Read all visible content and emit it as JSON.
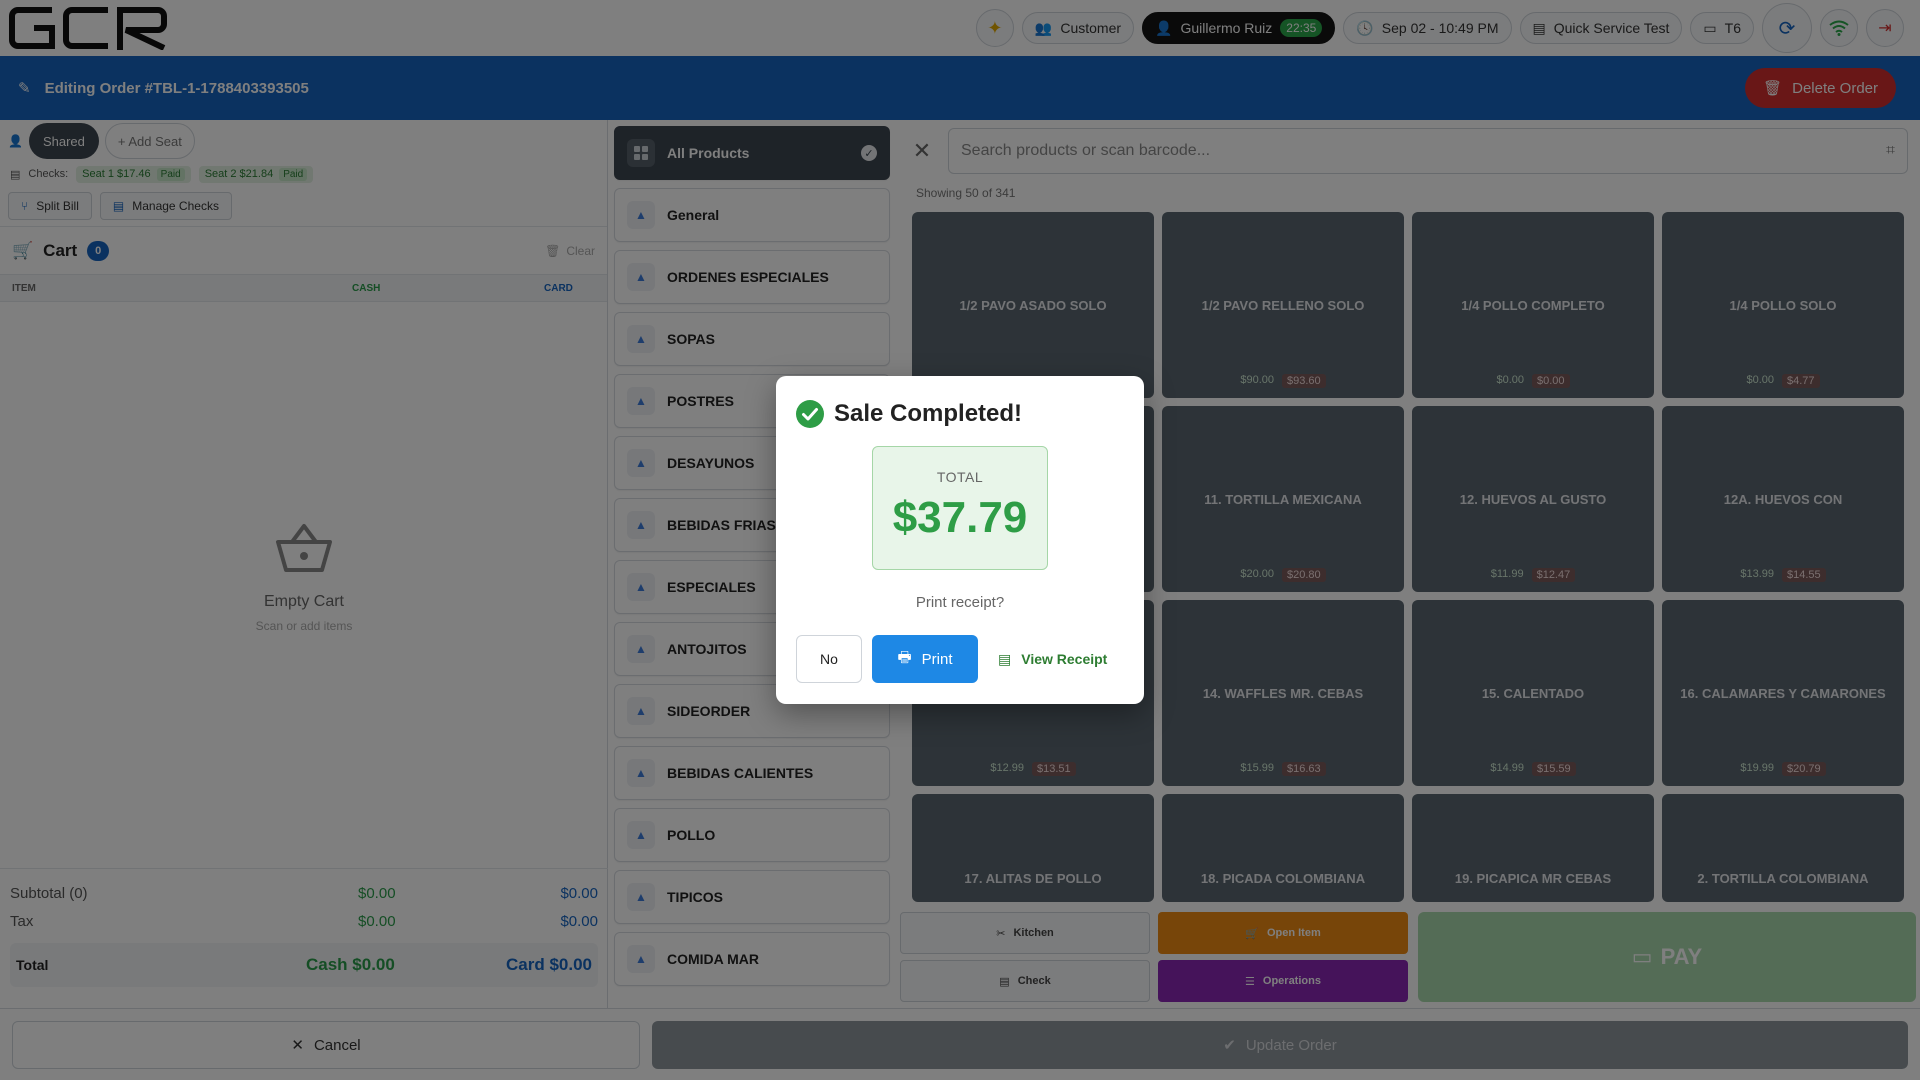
{
  "app": {
    "logo_text": "GCR"
  },
  "topbar": {
    "customer_label": "Customer",
    "user_name": "Guillermo Ruiz",
    "user_time": "22:35",
    "datetime": "Sep 02 - 10:49 PM",
    "store": "Quick Service Test",
    "terminal": "T6"
  },
  "header": {
    "title": "Editing Order #TBL-1-1788403393505",
    "delete_label": "Delete Order"
  },
  "seats": {
    "shared_label": "Shared",
    "add_label": "+ Add Seat",
    "checks_label": "Checks:",
    "checks": [
      {
        "label": "Seat 1 $17.46",
        "status": "Paid"
      },
      {
        "label": "Seat 2 $21.84",
        "status": "Paid"
      }
    ],
    "split_label": "Split Bill",
    "manage_label": "Manage Checks"
  },
  "cart": {
    "title": "Cart",
    "count": "0",
    "clear_label": "Clear",
    "col_item": "ITEM",
    "col_cash": "CASH",
    "col_card": "CARD",
    "empty_title": "Empty Cart",
    "empty_sub": "Scan or add items",
    "subtotal_label": "Subtotal (0)",
    "subtotal_cash": "$0.00",
    "subtotal_card": "$0.00",
    "tax_label": "Tax",
    "tax_cash": "$0.00",
    "tax_card": "$0.00",
    "total_label": "Total",
    "total_cash": "Cash $0.00",
    "total_card": "Card $0.00"
  },
  "categories": [
    "All Products",
    "General",
    "ORDENES ESPECIALES",
    "SOPAS",
    "POSTRES",
    "DESAYUNOS",
    "BEBIDAS FRIAS",
    "ESPECIALES",
    "ANTOJITOS",
    "SIDEORDER",
    "BEBIDAS CALIENTES",
    "POLLO",
    "TIPICOS",
    "COMIDA MAR"
  ],
  "search": {
    "placeholder": "Search products or scan barcode...",
    "showing": "Showing 50 of 341"
  },
  "products": [
    {
      "name": "1/2 PAVO ASADO SOLO",
      "cash": "",
      "card": ""
    },
    {
      "name": "1/2 PAVO RELLENO SOLO",
      "cash": "$90.00",
      "card": "$93.60"
    },
    {
      "name": "1/4 POLLO COMPLETO",
      "cash": "$0.00",
      "card": "$0.00"
    },
    {
      "name": "1/4 POLLO SOLO",
      "cash": "$0.00",
      "card": "$4.77"
    },
    {
      "name": "",
      "cash": "",
      "card": ""
    },
    {
      "name": "11. TORTILLA MEXICANA",
      "cash": "$20.00",
      "card": "$20.80"
    },
    {
      "name": "12. HUEVOS AL GUSTO",
      "cash": "$11.99",
      "card": "$12.47"
    },
    {
      "name": "12A. HUEVOS CON",
      "cash": "$13.99",
      "card": "$14.55"
    },
    {
      "name": "",
      "cash": "$12.99",
      "card": "$13.51"
    },
    {
      "name": "14. WAFFLES MR. CEBAS",
      "cash": "$15.99",
      "card": "$16.63"
    },
    {
      "name": "15. CALENTADO",
      "cash": "$14.99",
      "card": "$15.59"
    },
    {
      "name": "16. CALAMARES Y CAMARONES",
      "cash": "$19.99",
      "card": "$20.79"
    },
    {
      "name": "17. ALITAS DE POLLO",
      "cash": "",
      "card": ""
    },
    {
      "name": "18. PICADA COLOMBIANA",
      "cash": "",
      "card": ""
    },
    {
      "name": "19. PICAPICA MR CEBAS",
      "cash": "",
      "card": ""
    },
    {
      "name": "2. TORTILLA COLOMBIANA",
      "cash": "",
      "card": ""
    }
  ],
  "actions": {
    "kitchen": "Kitchen",
    "check": "Check",
    "open_item": "Open Item",
    "operations": "Operations",
    "pay": "PAY"
  },
  "footer": {
    "cancel": "Cancel",
    "update": "Update Order"
  },
  "modal": {
    "title": "Sale Completed!",
    "total_label": "TOTAL",
    "total_value": "$37.79",
    "question": "Print receipt?",
    "no": "No",
    "print": "Print",
    "view": "View Receipt"
  },
  "colors": {
    "brand_blue": "#1664c0",
    "success": "#2e9d46",
    "danger": "#d32f2f",
    "open_item": "#ef8a12",
    "operations": "#8a27b5"
  }
}
